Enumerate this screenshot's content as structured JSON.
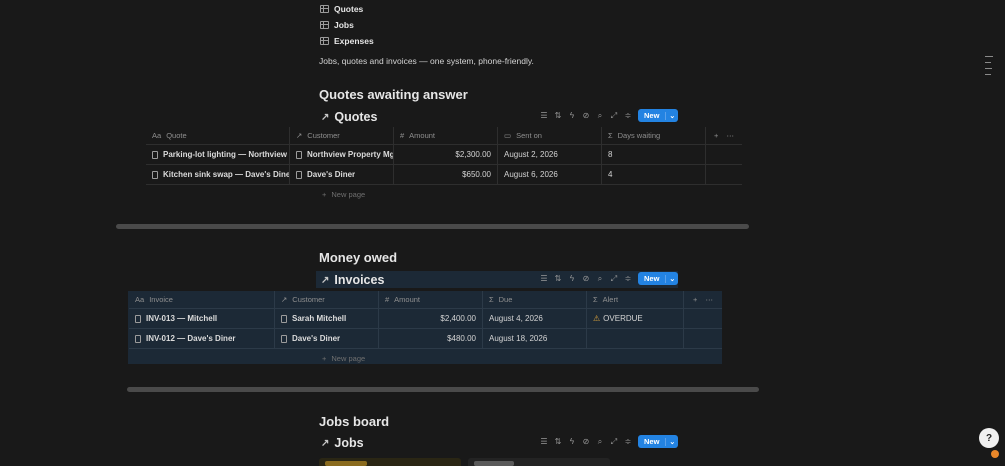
{
  "top_links": [
    {
      "label": "Quotes",
      "icon": "table-icon"
    },
    {
      "label": "Jobs",
      "icon": "table-icon"
    },
    {
      "label": "Expenses",
      "icon": "table-icon"
    }
  ],
  "intro_text": "Jobs, quotes and invoices — one system, phone-friendly.",
  "quotes_section": {
    "heading": "Quotes awaiting answer",
    "view_title": "Quotes",
    "new_label": "New",
    "columns": [
      {
        "icon": "Aa",
        "label": "Quote"
      },
      {
        "icon": "↗",
        "label": "Customer"
      },
      {
        "icon": "#",
        "label": "Amount"
      },
      {
        "icon": "▭",
        "label": "Sent on"
      },
      {
        "icon": "Σ",
        "label": "Days waiting"
      }
    ],
    "rows": [
      {
        "quote": "Parking-lot lighting — Northview",
        "customer": "Northview Property Mgmt",
        "amount": "$2,300.00",
        "sent_on": "August 2, 2026",
        "days": "8"
      },
      {
        "quote": "Kitchen sink swap — Dave's Diner",
        "customer": "Dave's Diner",
        "amount": "$650.00",
        "sent_on": "August 6, 2026",
        "days": "4"
      }
    ],
    "new_page_label": "New page"
  },
  "money_section": {
    "heading": "Money owed",
    "view_title": "Invoices",
    "new_label": "New",
    "columns": [
      {
        "icon": "Aa",
        "label": "Invoice"
      },
      {
        "icon": "↗",
        "label": "Customer"
      },
      {
        "icon": "#",
        "label": "Amount"
      },
      {
        "icon": "Σ",
        "label": "Due"
      },
      {
        "icon": "Σ",
        "label": "Alert"
      }
    ],
    "rows": [
      {
        "invoice": "INV-013 — Mitchell",
        "customer": "Sarah Mitchell",
        "amount": "$2,400.00",
        "due": "August 4, 2026",
        "alert": "OVERDUE"
      },
      {
        "invoice": "INV-012 — Dave's Diner",
        "customer": "Dave's Diner",
        "amount": "$480.00",
        "due": "August 18, 2026",
        "alert": ""
      }
    ],
    "new_page_label": "New page",
    "accent_bg": "#1c2936"
  },
  "jobs_section": {
    "heading": "Jobs board",
    "view_title": "Jobs",
    "new_label": "New"
  },
  "help_button": "?"
}
